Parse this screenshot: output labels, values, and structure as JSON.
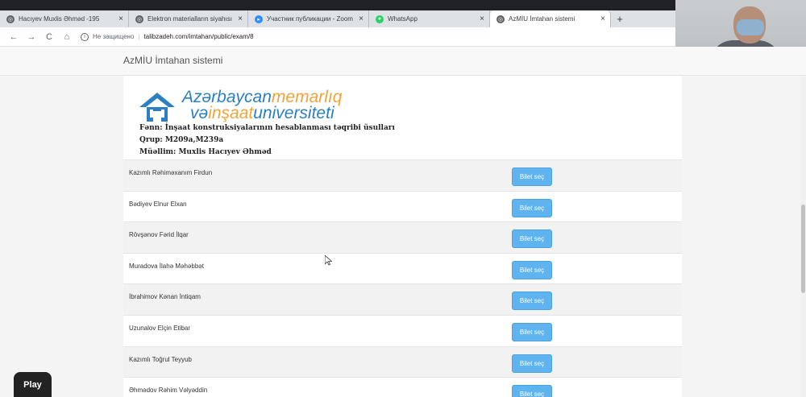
{
  "browser": {
    "tabs": [
      {
        "title": "Hacıyev Muxlis Əhməd -195",
        "icon": "globe-icon"
      },
      {
        "title": "Elektron materialların siyahısı",
        "icon": "globe-icon"
      },
      {
        "title": "Участник публикации - Zoom",
        "icon": "zoom-icon"
      },
      {
        "title": "WhatsApp",
        "icon": "whatsapp-icon"
      },
      {
        "title": "AzMİU İmtahan sistemi",
        "icon": "globe-icon",
        "active": true
      }
    ],
    "close_glyph": "×",
    "new_tab_glyph": "+",
    "nav": {
      "back": "←",
      "forward": "→",
      "reload": "C",
      "home": "⌂"
    },
    "address": {
      "security_text": "Не защищено",
      "url": "talibzadeh.com/imtahan/public/exam/8"
    }
  },
  "navbar": {
    "brand": "AzMİU İmtahan sistemi"
  },
  "logo": {
    "part1": "Azərbaycan",
    "part2": "memarlıq",
    "part3": "və",
    "part4": "inşaat",
    "part5": "universiteti"
  },
  "exam_info": {
    "subject": "Fənn: İnşaat konstruksiyalarının hesablanması təqribi üsulları",
    "group": "Qrup: M209a,M239a",
    "teacher": "Müəllim: Muxlis Hacıyev Əhməd"
  },
  "students": [
    {
      "name": "Kazımlı Rəhiməxanım Firdun",
      "button": "Bilet seç"
    },
    {
      "name": "Bədiyev Elnur Elxan",
      "button": "Bilet seç"
    },
    {
      "name": "Rövşənov Fərid İlqar",
      "button": "Bilet seç"
    },
    {
      "name": "Muradova İlahə Məhəbbət",
      "button": "Bilet seç"
    },
    {
      "name": "İbrahimov Kənan İntiqam",
      "button": "Bilet seç"
    },
    {
      "name": "Uzunalov Elçin Etibar",
      "button": "Bilet seç"
    },
    {
      "name": "Kazımlı Toğrul Teyyub",
      "button": "Bilet seç"
    },
    {
      "name": "Əhmədov Rəhim Vəlyəddin",
      "button": "Bilet seç"
    }
  ],
  "player": {
    "play_label": "Play"
  }
}
